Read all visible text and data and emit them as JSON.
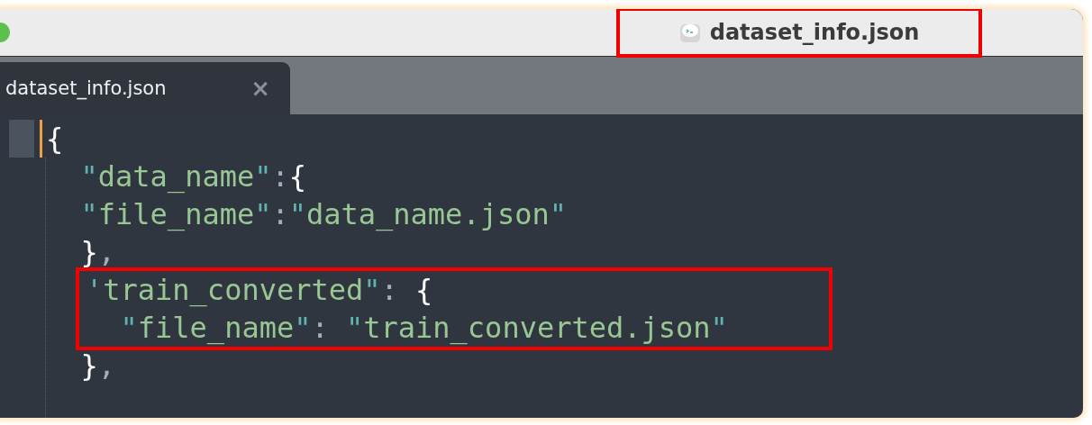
{
  "window": {
    "title": "dataset_info.json",
    "title_highlighted": true
  },
  "tabs": [
    {
      "label": "dataset_info.json",
      "selected": true,
      "close": "×"
    }
  ],
  "editor": {
    "lines": [
      {
        "highlighted": false,
        "current": true,
        "tokens": [
          {
            "kind": "punct",
            "text": "{"
          }
        ]
      },
      {
        "highlighted": false,
        "current": false,
        "tokens": [
          {
            "kind": "quote",
            "text": "  \""
          },
          {
            "kind": "string",
            "text": "data_name"
          },
          {
            "kind": "quote",
            "text": "\""
          },
          {
            "kind": "colon",
            "text": ":"
          },
          {
            "kind": "punct",
            "text": "{"
          }
        ]
      },
      {
        "highlighted": false,
        "current": false,
        "tokens": [
          {
            "kind": "quote",
            "text": "  \""
          },
          {
            "kind": "string",
            "text": "file_name"
          },
          {
            "kind": "quote",
            "text": "\""
          },
          {
            "kind": "colon",
            "text": ":"
          },
          {
            "kind": "quote",
            "text": "\""
          },
          {
            "kind": "string",
            "text": "data_name.json"
          },
          {
            "kind": "quote",
            "text": "\""
          }
        ]
      },
      {
        "highlighted": false,
        "current": false,
        "tokens": [
          {
            "kind": "punct",
            "text": "  }"
          },
          {
            "kind": "colon",
            "text": ","
          }
        ]
      },
      {
        "highlighted": true,
        "current": false,
        "tokens": [
          {
            "kind": "quote",
            "text": "'"
          },
          {
            "kind": "string",
            "text": "train_converted"
          },
          {
            "kind": "quote",
            "text": "\""
          },
          {
            "kind": "colon",
            "text": ": "
          },
          {
            "kind": "punct",
            "text": "{"
          }
        ]
      },
      {
        "highlighted": true,
        "current": false,
        "tokens": [
          {
            "kind": "quote",
            "text": "  \""
          },
          {
            "kind": "string",
            "text": "file_name"
          },
          {
            "kind": "quote",
            "text": "\""
          },
          {
            "kind": "colon",
            "text": ": "
          },
          {
            "kind": "quote",
            "text": "\""
          },
          {
            "kind": "string",
            "text": "train_converted.json"
          },
          {
            "kind": "quote",
            "text": "\""
          }
        ]
      },
      {
        "highlighted": false,
        "current": false,
        "tokens": [
          {
            "kind": "punct",
            "text": "  }"
          },
          {
            "kind": "colon",
            "text": ","
          }
        ]
      }
    ]
  }
}
